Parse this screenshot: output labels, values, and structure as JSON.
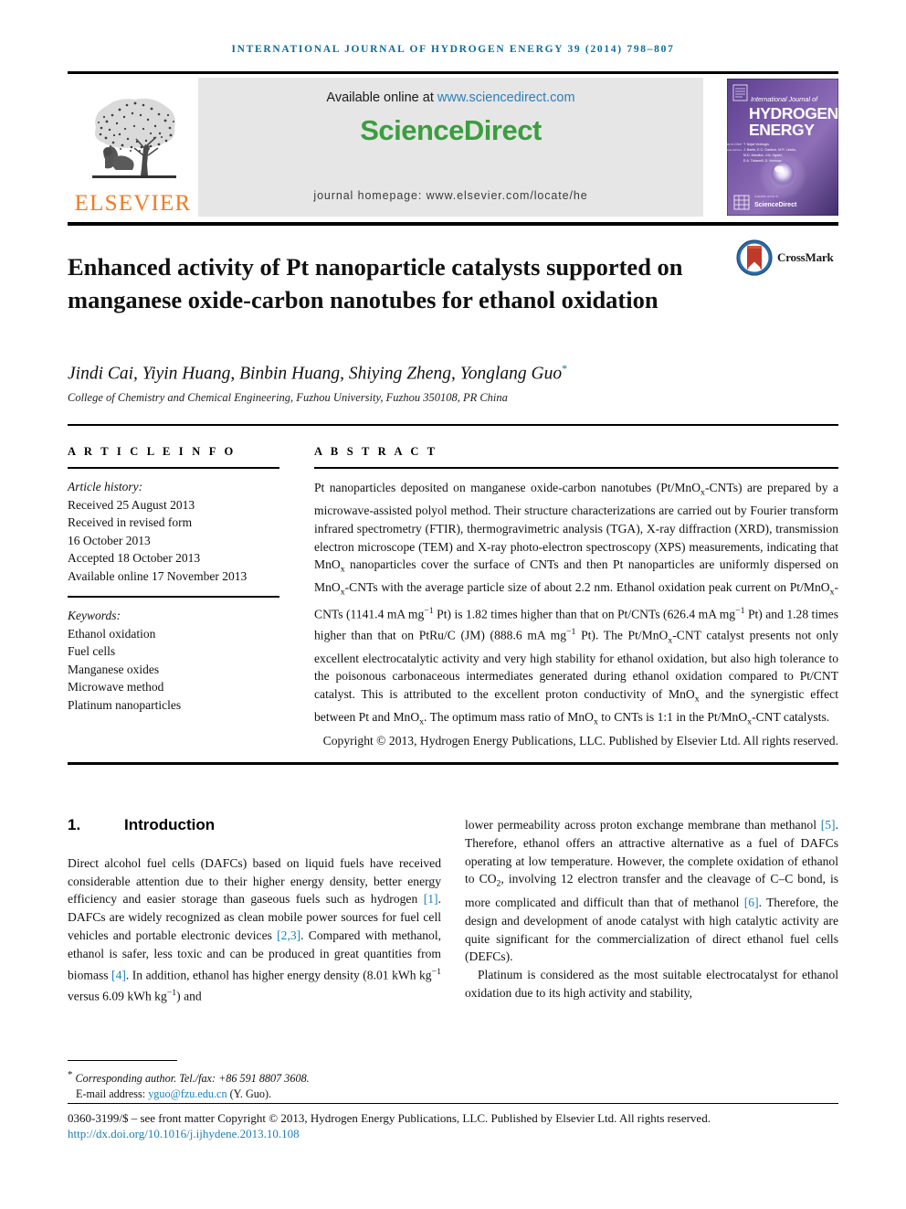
{
  "running_head": "International Journal of Hydrogen Energy 39 (2014) 798–807",
  "masthead": {
    "elsevier_wordmark": "ELSEVIER",
    "available_prefix": "Available online at ",
    "available_link": "www.sciencedirect.com",
    "sciencedirect_logo": "ScienceDirect",
    "journal_homepage": "journal homepage: www.elsevier.com/locate/he",
    "cover": {
      "line1": "International Journal of",
      "line2": "HYDROGEN",
      "line3": "ENERGY",
      "editor_label": "Editor-in-Chief",
      "editor": "T. Nejat Veziroglu",
      "assoc_label": "Associate Editors",
      "assoc1": "J. Barbir, E.C. Gardner, M.R. Lincks,",
      "assoc2": "M.D. Mamilov, J.M. Ogden,",
      "assoc3": "E.A. Ticianelli, D. Vezirogu",
      "footer_brand": "ScienceDirect"
    }
  },
  "title": "Enhanced activity of Pt nanoparticle catalysts supported on manganese oxide-carbon nanotubes for ethanol oxidation",
  "crossmark_label": "CrossMark",
  "authors": "Jindi Cai, Yiyin Huang, Binbin Huang, Shiying Zheng, Yonglang Guo",
  "author_star": "*",
  "affiliation": "College of Chemistry and Chemical Engineering, Fuzhou University, Fuzhou 350108, PR China",
  "article_info": {
    "heading": "A R T I C L E   I N F O",
    "history_label": "Article history:",
    "history": [
      "Received 25 August 2013",
      "Received in revised form",
      "16 October 2013",
      "Accepted 18 October 2013",
      "Available online 17 November 2013"
    ],
    "keywords_label": "Keywords:",
    "keywords": [
      "Ethanol oxidation",
      "Fuel cells",
      "Manganese oxides",
      "Microwave method",
      "Platinum nanoparticles"
    ]
  },
  "abstract": {
    "heading": "A B S T R A C T",
    "body_part1": "Pt nanoparticles deposited on manganese oxide-carbon nanotubes (Pt/MnO",
    "body_part1b": "-CNTs) are prepared by a microwave-assisted polyol method. Their structure characterizations are carried out by Fourier transform infrared spectrometry (FTIR), thermogravimetric analysis (TGA), X-ray diffraction (XRD), transmission electron microscope (TEM) and X-ray photo-electron spectroscopy (XPS) measurements, indicating that MnO",
    "body_part2": " nanoparticles cover the surface of CNTs and then Pt nanoparticles are uniformly dispersed on MnO",
    "body_part3": "-CNTs with the average particle size of about 2.2 nm. Ethanol oxidation peak current on Pt/MnO",
    "body_part4": "-CNTs (1141.4 mA mg",
    "body_part5": " Pt) is 1.82 times higher than that on Pt/CNTs (626.4 mA mg",
    "body_part6": " Pt) and 1.28 times higher than that on PtRu/C (JM) (888.6 mA mg",
    "body_part7": " Pt). The Pt/MnO",
    "body_part8": "-CNT catalyst presents not only excellent electrocatalytic activity and very high stability for ethanol oxidation, but also high tolerance to the poisonous carbonaceous intermediates generated during ethanol oxidation compared to Pt/CNT catalyst. This is attributed to the excellent proton conductivity of MnO",
    "body_part9": " and the synergistic effect between Pt and MnO",
    "body_part10": ". The optimum mass ratio of MnO",
    "body_part11": " to CNTs is 1:1 in the Pt/MnO",
    "body_part12": "-CNT catalysts.",
    "copyright": "Copyright © 2013, Hydrogen Energy Publications, LLC. Published by Elsevier Ltd. All rights reserved.",
    "sub_x": "x",
    "sup_minus1": "−1"
  },
  "introduction": {
    "number": "1.",
    "heading": "Introduction",
    "left_p1_a": "Direct alcohol fuel cells (DAFCs) based on liquid fuels have received considerable attention due to their higher energy density, better energy efficiency and easier storage than gaseous fuels such as hydrogen ",
    "ref1": "[1]",
    "left_p1_b": ". DAFCs are widely recognized as clean mobile power sources for fuel cell vehicles and portable electronic devices ",
    "ref23": "[2,3]",
    "left_p1_c": ". Compared with methanol, ethanol is safer, less toxic and can be produced in great quantities from biomass ",
    "ref4": "[4]",
    "left_p1_d": ". In addition, ethanol has higher energy density (8.01 kWh kg",
    "left_p1_e": " versus 6.09 kWh kg",
    "left_p1_f": ") and",
    "right_p1_a": "lower permeability across proton exchange membrane than methanol ",
    "ref5": "[5]",
    "right_p1_b": ". Therefore, ethanol offers an attractive alternative as a fuel of DAFCs operating at low temperature. However, the complete oxidation of ethanol to CO",
    "right_p1_c": ", involving 12 electron transfer and the cleavage of C–C bond, is more complicated and difficult than that of methanol ",
    "ref6": "[6]",
    "right_p1_d": ". Therefore, the design and development of anode catalyst with high catalytic activity are quite significant for the commercialization of direct ethanol fuel cells (DEFCs).",
    "right_p2": "Platinum is considered as the most suitable electrocatalyst for ethanol oxidation due to its high activity and stability,",
    "sup_minus1": "−1",
    "sub_2": "2"
  },
  "footnote": {
    "star": "*",
    "corresponding": "Corresponding author. Tel./fax: +86 591 8807 3608.",
    "email_label": "E-mail address: ",
    "email": "yguo@fzu.edu.cn",
    "email_suffix": " (Y. Guo)."
  },
  "footer": {
    "copyright": "0360-3199/$ – see front matter Copyright © 2013, Hydrogen Energy Publications, LLC. Published by Elsevier Ltd. All rights reserved.",
    "doi": "http://dx.doi.org/10.1016/j.ijhydene.2013.10.108"
  },
  "colors": {
    "header_blue": "#0b6d99",
    "link_blue": "#2e7eb5",
    "ref_blue": "#1a7fb5",
    "sciencedirect_green": "#3a9e3e",
    "elsevier_orange": "#f47920",
    "band_gray": "#e6e6e6"
  }
}
